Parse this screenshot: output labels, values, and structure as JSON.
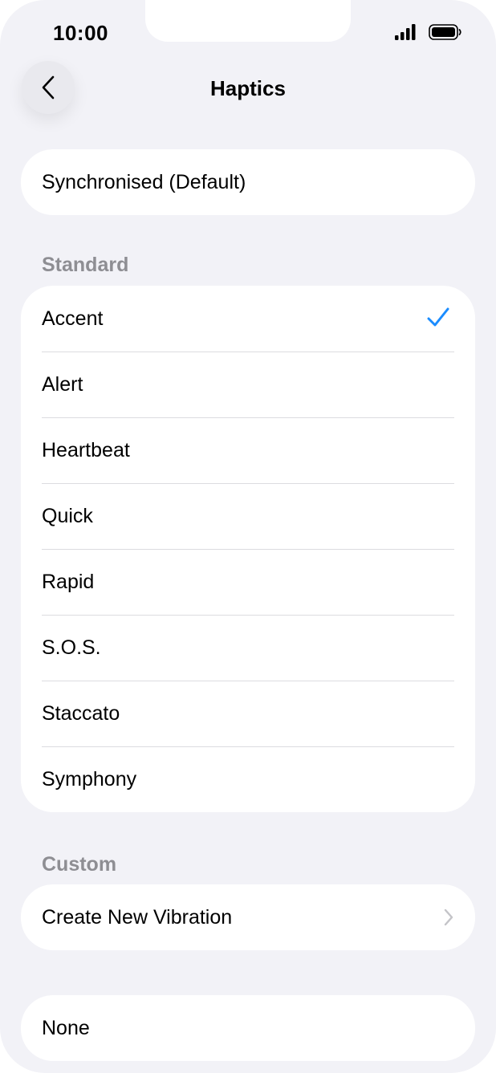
{
  "status_bar": {
    "time": "10:00"
  },
  "nav": {
    "title": "Haptics",
    "back_icon": "chevron-left-icon"
  },
  "default_option": {
    "label": "Synchronised (Default)"
  },
  "standard": {
    "header": "Standard",
    "selected": "Accent",
    "items": [
      {
        "label": "Accent"
      },
      {
        "label": "Alert"
      },
      {
        "label": "Heartbeat"
      },
      {
        "label": "Quick"
      },
      {
        "label": "Rapid"
      },
      {
        "label": "S.O.S."
      },
      {
        "label": "Staccato"
      },
      {
        "label": "Symphony"
      }
    ]
  },
  "custom": {
    "header": "Custom",
    "create_label": "Create New Vibration"
  },
  "none_option": {
    "label": "None"
  },
  "colors": {
    "accent": "#1a8cff",
    "background": "#f2f2f7",
    "secondary_text": "#8e8e93",
    "chevron": "#c4c4c8"
  }
}
